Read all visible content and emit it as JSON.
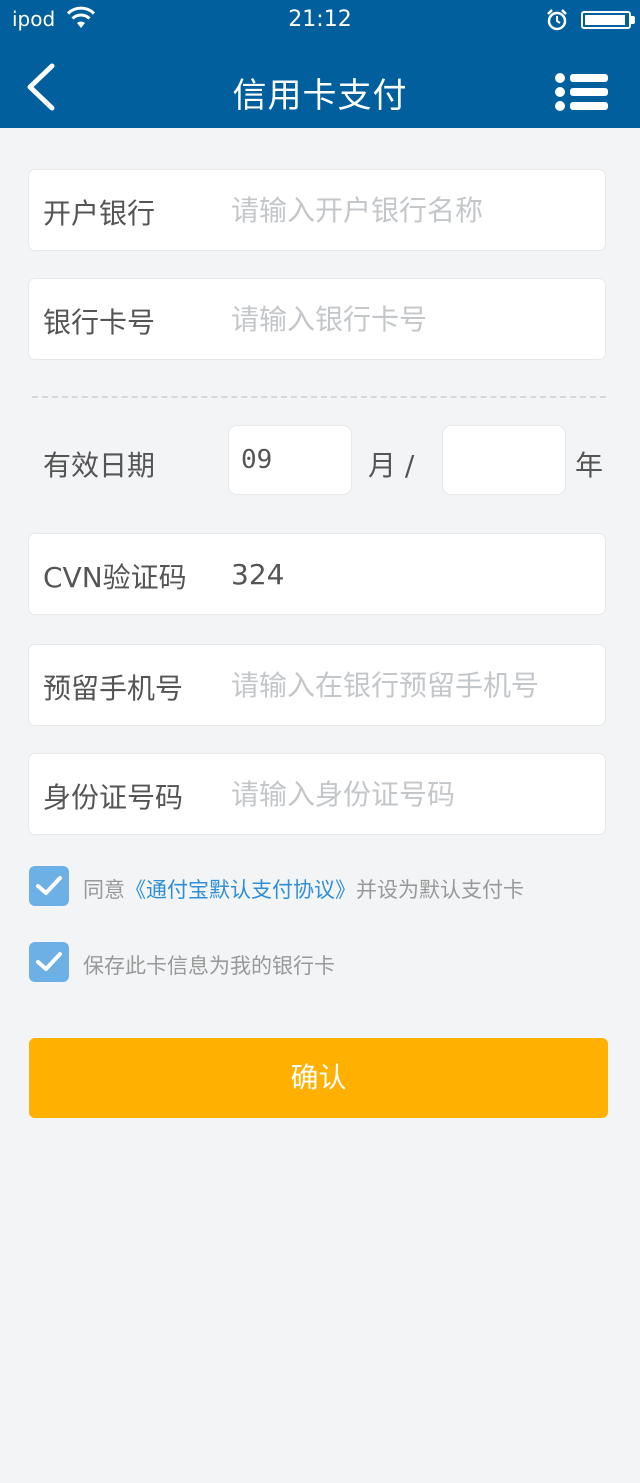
{
  "status_bar": {
    "carrier": "ipod",
    "time": "21:12",
    "battery_level": 0.95
  },
  "nav": {
    "title": "信用卡支付",
    "back_icon": "chevron-left-icon",
    "menu_icon": "list-menu-icon"
  },
  "form": {
    "bank": {
      "label": "开户银行",
      "placeholder": "请输入开户银行名称",
      "value": ""
    },
    "card_number": {
      "label": "银行卡号",
      "placeholder": "请输入银行卡号",
      "value": ""
    },
    "expiry": {
      "label": "有效日期",
      "month_value": "09",
      "month_unit": "月 /",
      "year_value": "",
      "year_unit": "年"
    },
    "cvn": {
      "label": "CVN验证码",
      "placeholder": "",
      "value": "324"
    },
    "phone": {
      "label": "预留手机号",
      "placeholder": "请输入在银行预留手机号",
      "value": ""
    },
    "id_number": {
      "label": "身份证号码",
      "placeholder": "请输入身份证号码",
      "value": ""
    }
  },
  "agreements": {
    "agree": {
      "checked": true,
      "prefix": "同意",
      "link": "《通付宝默认支付协议》",
      "suffix": "并设为默认支付卡"
    },
    "save_card": {
      "checked": true,
      "text": "保存此卡信息为我的银行卡"
    }
  },
  "confirm_label": "确认",
  "colors": {
    "header_bg": "#005f9c",
    "page_bg": "#f2f4f6",
    "checkbox": "#6cb0e6",
    "link": "#2e8fd6",
    "confirm_bg": "#ffb000"
  }
}
